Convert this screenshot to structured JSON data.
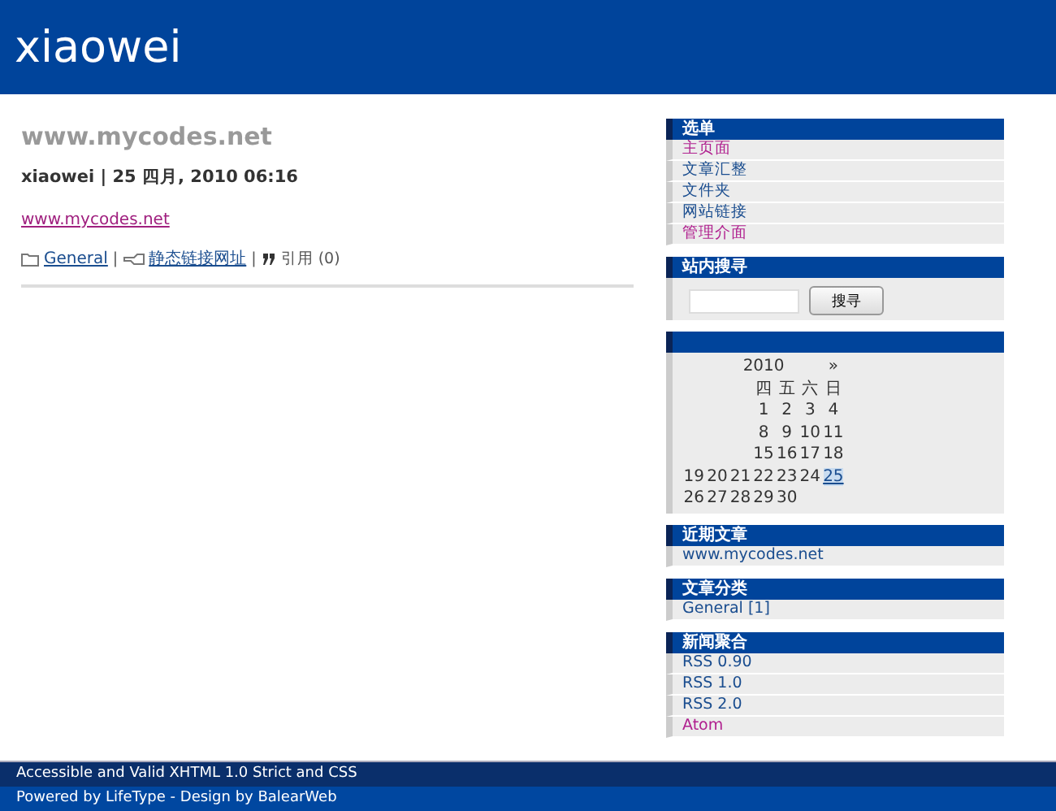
{
  "header": {
    "title": "xiaowei"
  },
  "post": {
    "title": "www.mycodes.net",
    "meta": "xiaowei | 25 四月, 2010 06:16",
    "body_link": "www.mycodes.net",
    "category": "General",
    "permalink": "静态链接网址",
    "separators": [
      "|",
      "|"
    ],
    "trackback": "引用 (0)"
  },
  "sidebar": [
    {
      "kind": "links",
      "title": "选单",
      "items": [
        {
          "label": "主页面",
          "visited": true
        },
        {
          "label": "文章汇整",
          "visited": false
        },
        {
          "label": "文件夹",
          "visited": false
        },
        {
          "label": "网站链接",
          "visited": false
        },
        {
          "label": "管理介面",
          "visited": true
        }
      ]
    },
    {
      "kind": "search",
      "title": "站内搜寻",
      "button": "搜寻"
    },
    {
      "kind": "calendar",
      "year": "2010",
      "next": "»",
      "weekdays": [
        "四",
        "五",
        "六",
        "日"
      ],
      "weeks": [
        {
          "days": [
            {
              "day": "1",
              "selected": false
            },
            {
              "day": "2",
              "selected": false
            },
            {
              "day": "3",
              "selected": false
            },
            {
              "day": "4",
              "selected": false
            }
          ]
        },
        {
          "days": [
            {
              "day": "8",
              "selected": false
            },
            {
              "day": "9",
              "selected": false
            },
            {
              "day": "10",
              "selected": false
            },
            {
              "day": "11",
              "selected": false
            }
          ]
        },
        {
          "days": [
            {
              "day": "15",
              "selected": false
            },
            {
              "day": "16",
              "selected": false
            },
            {
              "day": "17",
              "selected": false
            },
            {
              "day": "18",
              "selected": false
            }
          ]
        },
        {
          "days": [
            {
              "day": "19",
              "selected": false
            },
            {
              "day": "20",
              "selected": false
            },
            {
              "day": "21",
              "selected": false
            },
            {
              "day": "22",
              "selected": false
            },
            {
              "day": "23",
              "selected": false
            },
            {
              "day": "24",
              "selected": false
            },
            {
              "day": "25",
              "selected": true
            }
          ]
        },
        {
          "days": [
            {
              "day": "26",
              "selected": false
            },
            {
              "day": "27",
              "selected": false
            },
            {
              "day": "28",
              "selected": false
            },
            {
              "day": "29",
              "selected": false
            },
            {
              "day": "30",
              "selected": false
            }
          ]
        }
      ]
    },
    {
      "kind": "links",
      "title": "近期文章",
      "items": [
        {
          "label": "www.mycodes.net",
          "visited": false
        }
      ]
    },
    {
      "kind": "links",
      "title": "文章分类",
      "items": [
        {
          "label": "General [1]",
          "visited": false
        }
      ]
    },
    {
      "kind": "links",
      "title": "新闻聚合",
      "items": [
        {
          "label": "RSS 0.90",
          "visited": false
        },
        {
          "label": "RSS 1.0",
          "visited": false
        },
        {
          "label": "RSS 2.0",
          "visited": false
        },
        {
          "label": "Atom",
          "visited": true
        }
      ]
    }
  ],
  "footer": [
    "Accessible and Valid XHTML 1.0 Strict and CSS",
    "Powered by LifeType - Design by BalearWeb"
  ]
}
